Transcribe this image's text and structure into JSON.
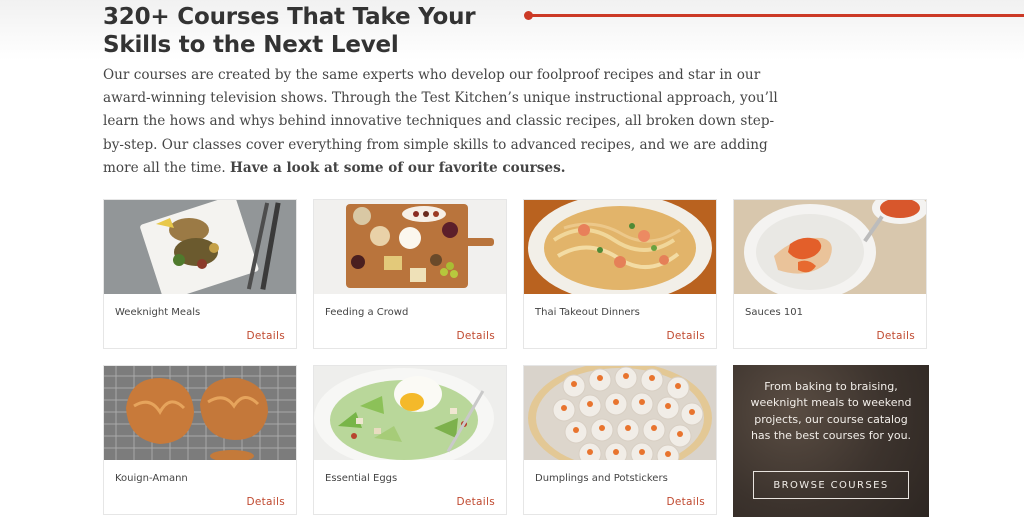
{
  "header": {
    "title": "320+ Courses That Take Your Skills to the Next Level",
    "intro": "Our courses are created by the same experts who develop our foolproof recipes and star in our award-winning television shows. Through the Test Kitchen’s unique instructional approach, you’ll learn the hows and whys behind innovative techniques and classic recipes, all broken down step-by-step. Our classes cover everything from simple skills to advanced recipes, and we are adding more all the time.",
    "intro_bold": "Have a look at some of our favorite courses.",
    "accent_color": "#cc3a26"
  },
  "courses": [
    {
      "name": "Weeknight Meals",
      "link": "Details"
    },
    {
      "name": "Feeding a Crowd",
      "link": "Details"
    },
    {
      "name": "Thai Takeout Dinners",
      "link": "Details"
    },
    {
      "name": "Sauces 101",
      "link": "Details"
    },
    {
      "name": "Kouign-Amann",
      "link": "Details"
    },
    {
      "name": "Essential Eggs",
      "link": "Details"
    },
    {
      "name": "Dumplings and Potstickers",
      "link": "Details"
    }
  ],
  "promo": {
    "text": "From baking to braising, weeknight meals to weekend projects, our course catalog has the best courses for you.",
    "button_label": "BROWSE COURSES"
  }
}
